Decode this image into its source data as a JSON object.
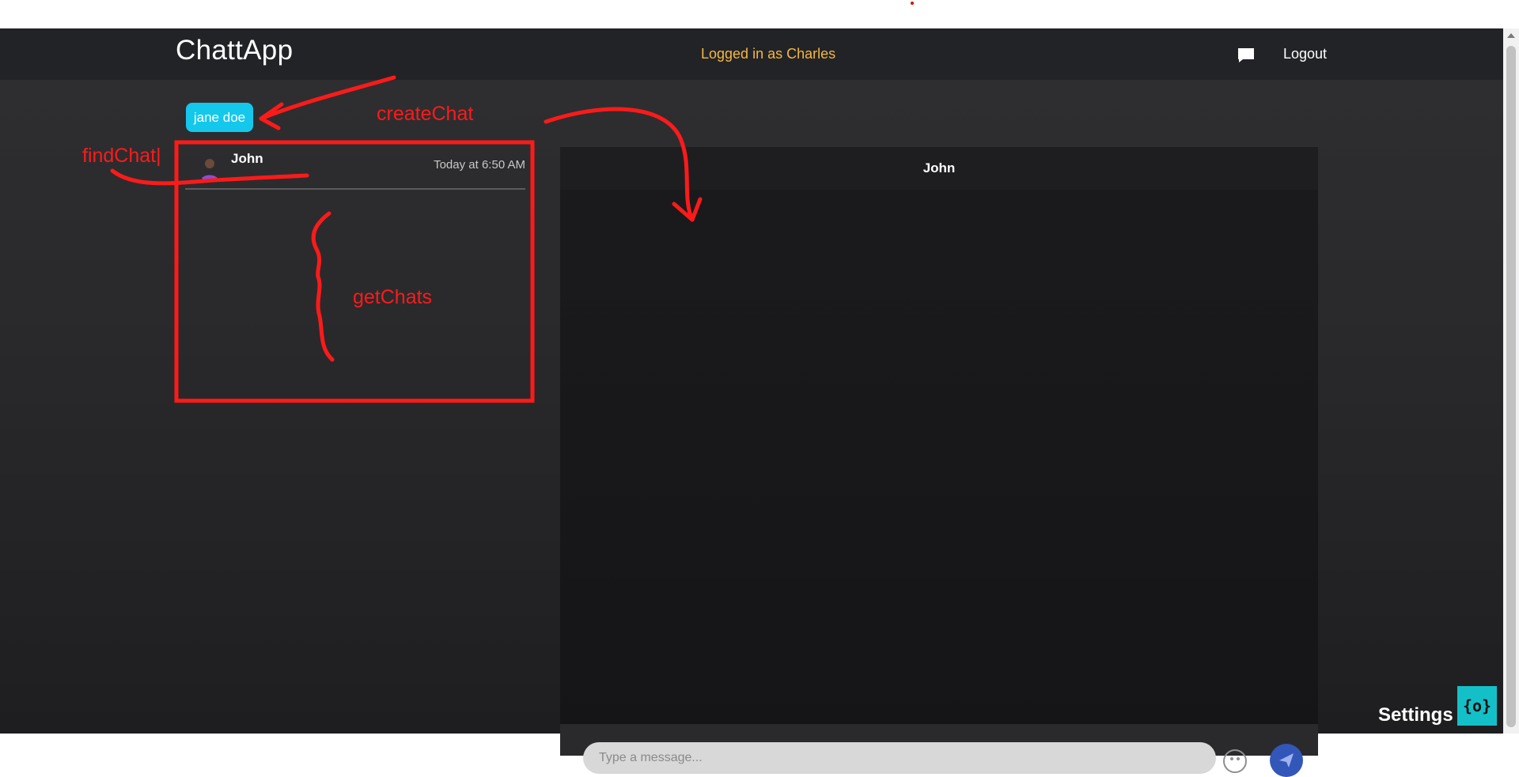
{
  "navbar": {
    "brand": "ChattApp",
    "logged_in_text": "Logged in as Charles",
    "logout_label": "Logout"
  },
  "potential_chats": [
    {
      "name": "jane doe"
    }
  ],
  "chat_list": [
    {
      "name": "John",
      "time": "Today at 6:50 AM"
    }
  ],
  "chat_box": {
    "recipient": "John",
    "input_placeholder": "Type a message..."
  },
  "settings": {
    "label": "Settings",
    "icon_text": "{o}"
  },
  "annotations": {
    "create_chat": "createChat",
    "find_chat": "findChat|",
    "get_chats": "getChats"
  },
  "colors": {
    "accent_cyan": "#14c8ec",
    "logged_in_yellow": "#f4b740",
    "send_blue": "#3257b8",
    "annotation_red": "#ff1a1a"
  }
}
